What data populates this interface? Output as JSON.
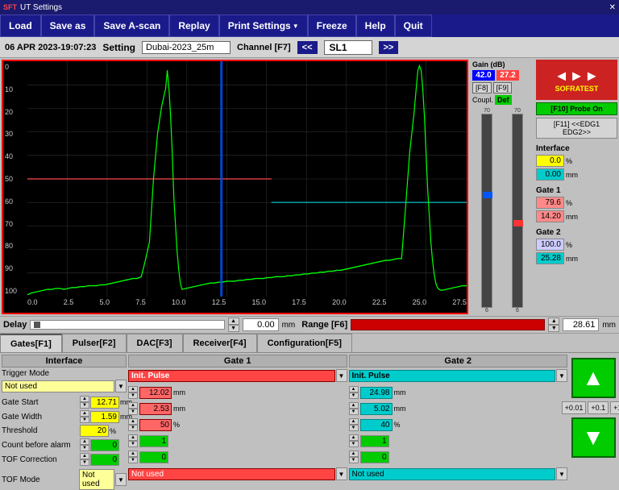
{
  "titleBar": {
    "icon": "SFT",
    "title": "UT Settings",
    "closeLabel": "✕"
  },
  "menuBar": {
    "buttons": [
      {
        "id": "load",
        "label": "Load"
      },
      {
        "id": "saveas",
        "label": "Save as"
      },
      {
        "id": "saveascan",
        "label": "Save A-scan"
      },
      {
        "id": "replay",
        "label": "Replay"
      },
      {
        "id": "printsettings",
        "label": "Print Settings"
      },
      {
        "id": "freeze",
        "label": "Freeze"
      },
      {
        "id": "help",
        "label": "Help"
      },
      {
        "id": "quit",
        "label": "Quit"
      }
    ]
  },
  "infoBar": {
    "datetime": "06 APR 2023-19:07:23",
    "settingLabel": "Setting",
    "settingValue": "Dubai-2023_25m",
    "channelLabel": "Channel [F7]",
    "navPrev": "<<",
    "navNext": ">>",
    "slValue": "SL1"
  },
  "gainPanel": {
    "label": "Gain (dB)",
    "f8label": "[F8]",
    "f9label": "[F9]",
    "val1": "42.0",
    "val2": "27.2",
    "couplLabel": "Coupl.",
    "couplVal": "Def",
    "f10": "[F10] Probe On",
    "f11": "[F11] <<EDG1 EDG2>>"
  },
  "rightPanel": {
    "interfaceLabel": "Interface",
    "interfaceVal1": "0.0",
    "interfaceUnit1": "%",
    "interfaceVal2": "0.00",
    "interfaceUnit2": "mm",
    "gate1Label": "Gate 1",
    "gate1Val1": "79.6",
    "gate1Unit1": "%",
    "gate1Val2": "14.20",
    "gate1Unit2": "mm",
    "gate2Label": "Gate 2",
    "gate2Val1": "100.0",
    "gate2Unit1": "%",
    "gate2Val2": "25.28",
    "gate2Unit2": "mm"
  },
  "delayBar": {
    "delayLabel": "Delay",
    "delayVal": "0.00",
    "delayUnit": "mm",
    "rangeLabel": "Range [F6]",
    "rangeVal": "28.61",
    "rangeUnit": "mm"
  },
  "tabs": [
    {
      "id": "gates",
      "label": "Gates[F1]",
      "active": true
    },
    {
      "id": "pulser",
      "label": "Pulser[F2]"
    },
    {
      "id": "dac",
      "label": "DAC[F3]"
    },
    {
      "id": "receiver",
      "label": "Receiver[F4]"
    },
    {
      "id": "config",
      "label": "Configuration[F5]"
    }
  ],
  "bottomPanel": {
    "interfaceSection": {
      "title": "Interface",
      "triggerMode": {
        "label": "Trigger Mode",
        "value": "Not used"
      },
      "gateStart": {
        "label": "Gate Start",
        "value": "12.71",
        "unit": "mm"
      },
      "gateWidth": {
        "label": "Gate Width",
        "value": "1.59",
        "unit": "mm"
      },
      "threshold": {
        "label": "Threshold",
        "value": "20",
        "unit": "%"
      },
      "countBeforeAlarm": {
        "label": "Count before alarm",
        "value": "0"
      },
      "tofCorrection": {
        "label": "TOF Correction",
        "value": "0"
      },
      "tofMode": {
        "label": "TOF Mode",
        "value": "Not used"
      }
    },
    "gate1Section": {
      "title": "Gate 1",
      "triggerMode": "Init. Pulse",
      "gateStart": {
        "value": "12.02",
        "unit": "mm"
      },
      "gateWidth": {
        "value": "2.53",
        "unit": "mm"
      },
      "threshold": {
        "value": "50",
        "unit": "%"
      },
      "countBeforeAlarm": {
        "value": "1"
      },
      "tofCorrection": {
        "value": "0"
      },
      "tofMode": "Not used"
    },
    "gate2Section": {
      "title": "Gate 2",
      "triggerMode": "Init. Pulse",
      "gateStart": {
        "value": "24.98",
        "unit": "mm"
      },
      "gateWidth": {
        "value": "5.02",
        "unit": "mm"
      },
      "threshold": {
        "value": "40",
        "unit": "%"
      },
      "countBeforeAlarm": {
        "value": "1"
      },
      "tofCorrection": {
        "value": "0"
      },
      "tofMode": "Not used"
    }
  },
  "arrowButtons": {
    "upLabel": "▲",
    "downLabel": "▼",
    "small1": "+0.01",
    "small2": "+0.1",
    "small3": "+1"
  },
  "yAxisLabels": [
    "100",
    "90",
    "80",
    "70",
    "60",
    "50",
    "40",
    "30",
    "20",
    "10",
    "0"
  ],
  "xAxisLabels": [
    "0.0",
    "2.5",
    "5.0",
    "7.5",
    "10.0",
    "12.5",
    "15.0",
    "17.5",
    "20.0",
    "22.5",
    "25.0",
    "27.5"
  ]
}
